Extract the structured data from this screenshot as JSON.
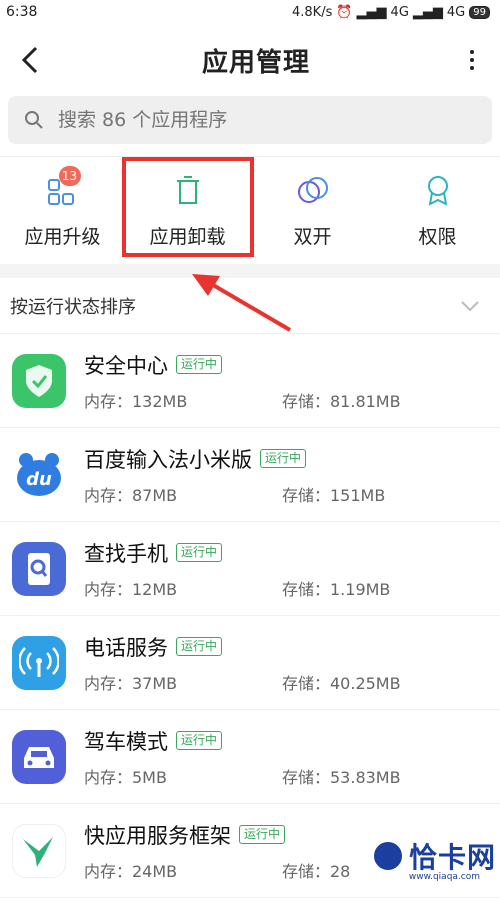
{
  "status_bar": {
    "time": "6:38",
    "net": "4.8K/s",
    "signal1": "4G",
    "signal2": "4G",
    "battery": "99"
  },
  "header": {
    "title": "应用管理"
  },
  "search": {
    "placeholder": "搜索 86 个应用程序"
  },
  "quick_actions": [
    {
      "label": "应用升级",
      "badge": "13"
    },
    {
      "label": "应用卸载"
    },
    {
      "label": "双开"
    },
    {
      "label": "权限"
    }
  ],
  "sort": {
    "label": "按运行状态排序"
  },
  "apps": [
    {
      "name": "安全中心",
      "status": "运行中",
      "memory": "内存：132MB",
      "storage": "存储：81.81MB",
      "color": "#3cc46a"
    },
    {
      "name": "百度输入法小米版",
      "status": "运行中",
      "memory": "内存：87MB",
      "storage": "存储：151MB",
      "color": "#2f7de1"
    },
    {
      "name": "查找手机",
      "status": "运行中",
      "memory": "内存：12MB",
      "storage": "存储：1.19MB",
      "color": "#4a6ad6"
    },
    {
      "name": "电话服务",
      "status": "运行中",
      "memory": "内存：37MB",
      "storage": "存储：40.25MB",
      "color": "#2fa0e6"
    },
    {
      "name": "驾车模式",
      "status": "运行中",
      "memory": "内存：5MB",
      "storage": "存储：53.83MB",
      "color": "#5160d8"
    },
    {
      "name": "快应用服务框架",
      "status": "运行中",
      "memory": "内存：24MB",
      "storage": "存储：28",
      "color": "#2fb27a"
    }
  ],
  "watermark": {
    "text": "恰卡网",
    "sub": "www.qiaqa.com"
  },
  "colors": {
    "accent": "#3aa75a",
    "highlight": "#e8332e",
    "badge": "#f06a5a"
  }
}
